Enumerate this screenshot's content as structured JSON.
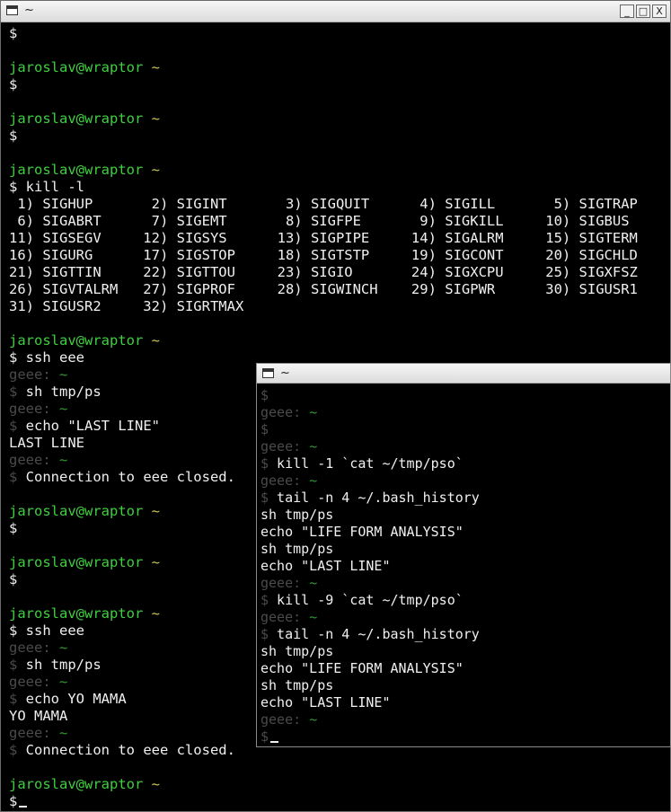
{
  "window1": {
    "title": "~",
    "controls": [
      "_",
      "□",
      "X"
    ],
    "lines": [
      {
        "kind": "prompt",
        "text": "$"
      },
      {
        "kind": "blank"
      },
      {
        "kind": "host",
        "user": "jaroslav@wraptor",
        "dir": "~"
      },
      {
        "kind": "prompt",
        "text": "$"
      },
      {
        "kind": "blank"
      },
      {
        "kind": "host",
        "user": "jaroslav@wraptor",
        "dir": "~"
      },
      {
        "kind": "prompt",
        "text": "$"
      },
      {
        "kind": "blank"
      },
      {
        "kind": "host",
        "user": "jaroslav@wraptor",
        "dir": "~"
      },
      {
        "kind": "prompt",
        "text": "$ kill -l"
      },
      {
        "kind": "out",
        "text": " 1) SIGHUP       2) SIGINT       3) SIGQUIT      4) SIGILL       5) SIGTRAP"
      },
      {
        "kind": "out",
        "text": " 6) SIGABRT      7) SIGEMT       8) SIGFPE       9) SIGKILL     10) SIGBUS"
      },
      {
        "kind": "out",
        "text": "11) SIGSEGV     12) SIGSYS      13) SIGPIPE     14) SIGALRM     15) SIGTERM"
      },
      {
        "kind": "out",
        "text": "16) SIGURG      17) SIGSTOP     18) SIGTSTP     19) SIGCONT     20) SIGCHLD"
      },
      {
        "kind": "out",
        "text": "21) SIGTTIN     22) SIGTTOU     23) SIGIO       24) SIGXCPU     25) SIGXFSZ"
      },
      {
        "kind": "out",
        "text": "26) SIGVTALRM   27) SIGPROF     28) SIGWINCH    29) SIGPWR      30) SIGUSR1"
      },
      {
        "kind": "out",
        "text": "31) SIGUSR2     32) SIGRTMAX"
      },
      {
        "kind": "blank"
      },
      {
        "kind": "host",
        "user": "jaroslav@wraptor",
        "dir": "~"
      },
      {
        "kind": "prompt",
        "text": "$ ssh eee"
      },
      {
        "kind": "rhost",
        "user": "geee:",
        "dir": "~"
      },
      {
        "kind": "rprompt",
        "sym": "$",
        "text": " sh tmp/ps"
      },
      {
        "kind": "rhost",
        "user": "geee:",
        "dir": "~"
      },
      {
        "kind": "rprompt",
        "sym": "$",
        "text": " echo \"LAST LINE\""
      },
      {
        "kind": "out",
        "text": "LAST LINE"
      },
      {
        "kind": "rhost",
        "user": "geee:",
        "dir": "~"
      },
      {
        "kind": "rprompt",
        "sym": "$",
        "text": " Connection to eee closed."
      },
      {
        "kind": "blank"
      },
      {
        "kind": "host",
        "user": "jaroslav@wraptor",
        "dir": "~"
      },
      {
        "kind": "prompt",
        "text": "$"
      },
      {
        "kind": "blank"
      },
      {
        "kind": "host",
        "user": "jaroslav@wraptor",
        "dir": "~"
      },
      {
        "kind": "prompt",
        "text": "$"
      },
      {
        "kind": "blank"
      },
      {
        "kind": "host",
        "user": "jaroslav@wraptor",
        "dir": "~"
      },
      {
        "kind": "prompt",
        "text": "$ ssh eee"
      },
      {
        "kind": "rhost",
        "user": "geee:",
        "dir": "~"
      },
      {
        "kind": "rprompt",
        "sym": "$",
        "text": " sh tmp/ps"
      },
      {
        "kind": "rhost",
        "user": "geee:",
        "dir": "~"
      },
      {
        "kind": "rprompt",
        "sym": "$",
        "text": " echo YO MAMA"
      },
      {
        "kind": "out",
        "text": "YO MAMA"
      },
      {
        "kind": "rhost",
        "user": "geee:",
        "dir": "~"
      },
      {
        "kind": "rprompt",
        "sym": "$",
        "text": " Connection to eee closed."
      },
      {
        "kind": "blank"
      },
      {
        "kind": "host",
        "user": "jaroslav@wraptor",
        "dir": "~"
      },
      {
        "kind": "prompt",
        "text": "$",
        "cursor": true
      }
    ]
  },
  "window2": {
    "title": "~",
    "lines": [
      {
        "kind": "rprompt",
        "sym": "$",
        "text": ""
      },
      {
        "kind": "rhost",
        "user": "geee:",
        "dir": "~"
      },
      {
        "kind": "rprompt",
        "sym": "$",
        "text": ""
      },
      {
        "kind": "rhost",
        "user": "geee:",
        "dir": "~"
      },
      {
        "kind": "rprompt",
        "sym": "$",
        "text": " kill -1 `cat ~/tmp/pso`"
      },
      {
        "kind": "rhost",
        "user": "geee:",
        "dir": "~"
      },
      {
        "kind": "rprompt",
        "sym": "$",
        "text": " tail -n 4 ~/.bash_history"
      },
      {
        "kind": "out",
        "text": "sh tmp/ps"
      },
      {
        "kind": "out",
        "text": "echo \"LIFE FORM ANALYSIS\""
      },
      {
        "kind": "out",
        "text": "sh tmp/ps"
      },
      {
        "kind": "out",
        "text": "echo \"LAST LINE\""
      },
      {
        "kind": "rhost",
        "user": "geee:",
        "dir": "~"
      },
      {
        "kind": "rprompt",
        "sym": "$",
        "text": " kill -9 `cat ~/tmp/pso`"
      },
      {
        "kind": "rhost",
        "user": "geee:",
        "dir": "~"
      },
      {
        "kind": "rprompt",
        "sym": "$",
        "text": " tail -n 4 ~/.bash_history"
      },
      {
        "kind": "out",
        "text": "sh tmp/ps"
      },
      {
        "kind": "out",
        "text": "echo \"LIFE FORM ANALYSIS\""
      },
      {
        "kind": "out",
        "text": "sh tmp/ps"
      },
      {
        "kind": "out",
        "text": "echo \"LAST LINE\""
      },
      {
        "kind": "rhost",
        "user": "geee:",
        "dir": "~"
      },
      {
        "kind": "rprompt",
        "sym": "$",
        "text": "",
        "cursor": true
      }
    ]
  },
  "colors": {
    "background": "#000000",
    "text": "#f0f0f0",
    "local_user": "#3fcf3f",
    "home_dir": "#c9c94a",
    "remote_dim": "#4b4b4b"
  }
}
